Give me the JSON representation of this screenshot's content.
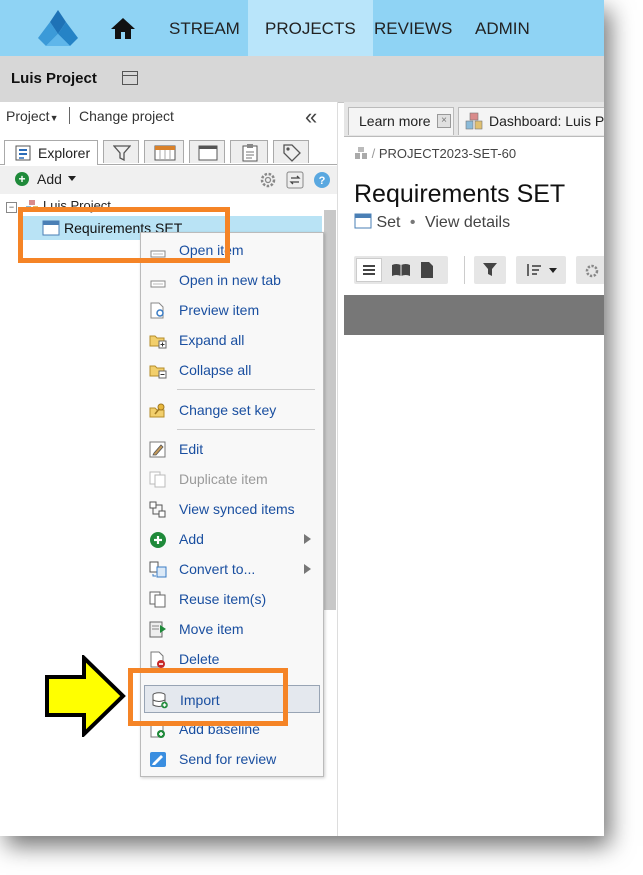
{
  "nav": {
    "items": [
      {
        "label": "STREAM",
        "active": false
      },
      {
        "label": "PROJECTS",
        "active": true
      },
      {
        "label": "REVIEWS",
        "active": false
      },
      {
        "label": "ADMIN",
        "active": false
      }
    ],
    "logo_icon": "jama-logo",
    "home_icon": "home-icon"
  },
  "project_header": {
    "name": "Luis Project"
  },
  "left_panel": {
    "project_dropdown": "Project",
    "change_project": "Change project",
    "tabs": [
      {
        "label": "Explorer",
        "icon": "explorer-icon",
        "active": true
      },
      {
        "label": "",
        "icon": "filter-icon"
      },
      {
        "label": "",
        "icon": "calendar-icon"
      },
      {
        "label": "",
        "icon": "window-icon"
      },
      {
        "label": "",
        "icon": "clipboard-icon"
      },
      {
        "label": "",
        "icon": "tag-icon"
      }
    ],
    "add_label": "Add",
    "tree": {
      "root": "Luis Project",
      "selected_node": "Requirements SET"
    }
  },
  "context_menu": {
    "items": [
      {
        "label": "Open item",
        "icon": "open-item-icon"
      },
      {
        "label": "Open in new tab",
        "icon": "open-new-tab-icon"
      },
      {
        "label": "Preview item",
        "icon": "preview-icon"
      },
      {
        "label": "Expand all",
        "icon": "expand-all-icon"
      },
      {
        "label": "Collapse all",
        "icon": "collapse-all-icon"
      },
      {
        "label": "Change set key",
        "icon": "key-icon"
      },
      {
        "label": "Edit",
        "icon": "edit-icon"
      },
      {
        "label": "Duplicate item",
        "icon": "duplicate-icon",
        "disabled": true
      },
      {
        "label": "View synced items",
        "icon": "synced-icon"
      },
      {
        "label": "Add",
        "icon": "add-icon",
        "submenu": true
      },
      {
        "label": "Convert to...",
        "icon": "convert-icon",
        "submenu": true
      },
      {
        "label": "Reuse item(s)",
        "icon": "reuse-icon"
      },
      {
        "label": "Move item",
        "icon": "move-icon"
      },
      {
        "label": "Delete",
        "icon": "delete-icon"
      },
      {
        "label": "Import",
        "icon": "import-icon",
        "highlighted": true
      },
      {
        "label": "Add baseline",
        "icon": "baseline-icon"
      },
      {
        "label": "Send for review",
        "icon": "review-icon"
      }
    ]
  },
  "right_panel": {
    "tabs": [
      {
        "label": "Learn more"
      },
      {
        "label": "Dashboard: Luis Pr"
      }
    ],
    "breadcrumb": "PROJECT2023-SET-60",
    "title": "Requirements SET",
    "item_type": "Set",
    "bullet": "•",
    "view_details": "View details"
  },
  "colors": {
    "nav_bg": "#8fd3f4",
    "nav_active": "#b9e5fa",
    "link_blue": "#1a4fa0",
    "highlight_orange": "#f58426",
    "arrow_yellow": "#ffff00"
  }
}
